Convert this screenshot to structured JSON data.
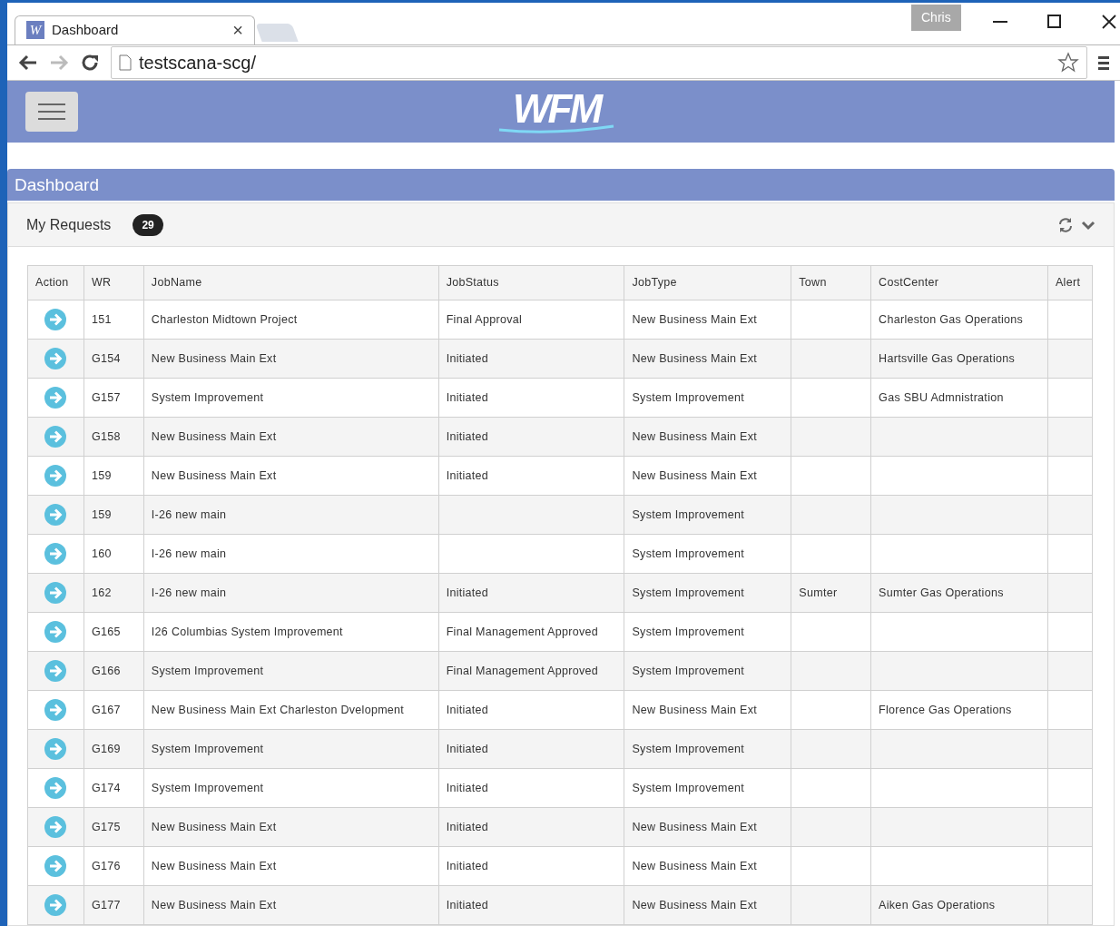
{
  "browser": {
    "tab": {
      "favicon": "W",
      "title": "Dashboard",
      "close": "×"
    },
    "profile": "Chris",
    "address": "testscana-scg/"
  },
  "app": {
    "logo": "WFM"
  },
  "page_title": "Dashboard",
  "panel": {
    "title": "My Requests",
    "count": "29"
  },
  "table": {
    "columns": [
      "Action",
      "WR",
      "JobName",
      "JobStatus",
      "JobType",
      "Town",
      "CostCenter",
      "Alert"
    ],
    "rows": [
      {
        "wr": "151",
        "job_name": "Charleston Midtown Project",
        "job_status": "Final Approval",
        "job_type": "New Business Main Ext",
        "cost_center": "Charleston Gas Operations"
      },
      {
        "wr": "G154",
        "job_name": "New Business Main Ext",
        "job_status": "Initiated",
        "job_type": "New Business Main Ext",
        "cost_center": "Hartsville Gas Operations"
      },
      {
        "wr": "G157",
        "job_name": "System Improvement",
        "job_status": "Initiated",
        "job_type": "System Improvement",
        "cost_center": "Gas SBU Admnistration"
      },
      {
        "wr": "G158",
        "job_name": "New Business Main Ext",
        "job_status": "Initiated",
        "job_type": "New Business Main Ext"
      },
      {
        "wr": "159",
        "job_name": "New Business Main Ext",
        "job_status": "Initiated",
        "job_type": "New Business Main Ext"
      },
      {
        "wr": "159",
        "job_name": "I-26 new main",
        "job_type": "System Improvement"
      },
      {
        "wr": "160",
        "job_name": "I-26 new main",
        "job_type": "System Improvement"
      },
      {
        "wr": "162",
        "job_name": "I-26 new main",
        "job_status": "Initiated",
        "job_type": "System Improvement",
        "town": "Sumter",
        "cost_center": "Sumter Gas Operations"
      },
      {
        "wr": "G165",
        "job_name": "I26 Columbias System Improvement",
        "job_status": "Final Management Approved",
        "job_type": "System Improvement"
      },
      {
        "wr": "G166",
        "job_name": "System Improvement",
        "job_status": "Final Management Approved",
        "job_type": "System Improvement"
      },
      {
        "wr": "G167",
        "job_name": "New Business Main Ext Charleston Dvelopment",
        "job_status": "Initiated",
        "job_type": "New Business Main Ext",
        "cost_center": "Florence Gas Operations"
      },
      {
        "wr": "G169",
        "job_name": "System Improvement",
        "job_status": "Initiated",
        "job_type": "System Improvement"
      },
      {
        "wr": "G174",
        "job_name": "System Improvement",
        "job_status": "Initiated",
        "job_type": "System Improvement"
      },
      {
        "wr": "G175",
        "job_name": "New Business Main Ext",
        "job_status": "Initiated",
        "job_type": "New Business Main Ext"
      },
      {
        "wr": "G176",
        "job_name": "New Business Main Ext",
        "job_status": "Initiated",
        "job_type": "New Business Main Ext"
      },
      {
        "wr": "G177",
        "job_name": "New Business Main Ext",
        "job_status": "Initiated",
        "job_type": "New Business Main Ext",
        "cost_center": "Aiken Gas Operations"
      }
    ]
  }
}
